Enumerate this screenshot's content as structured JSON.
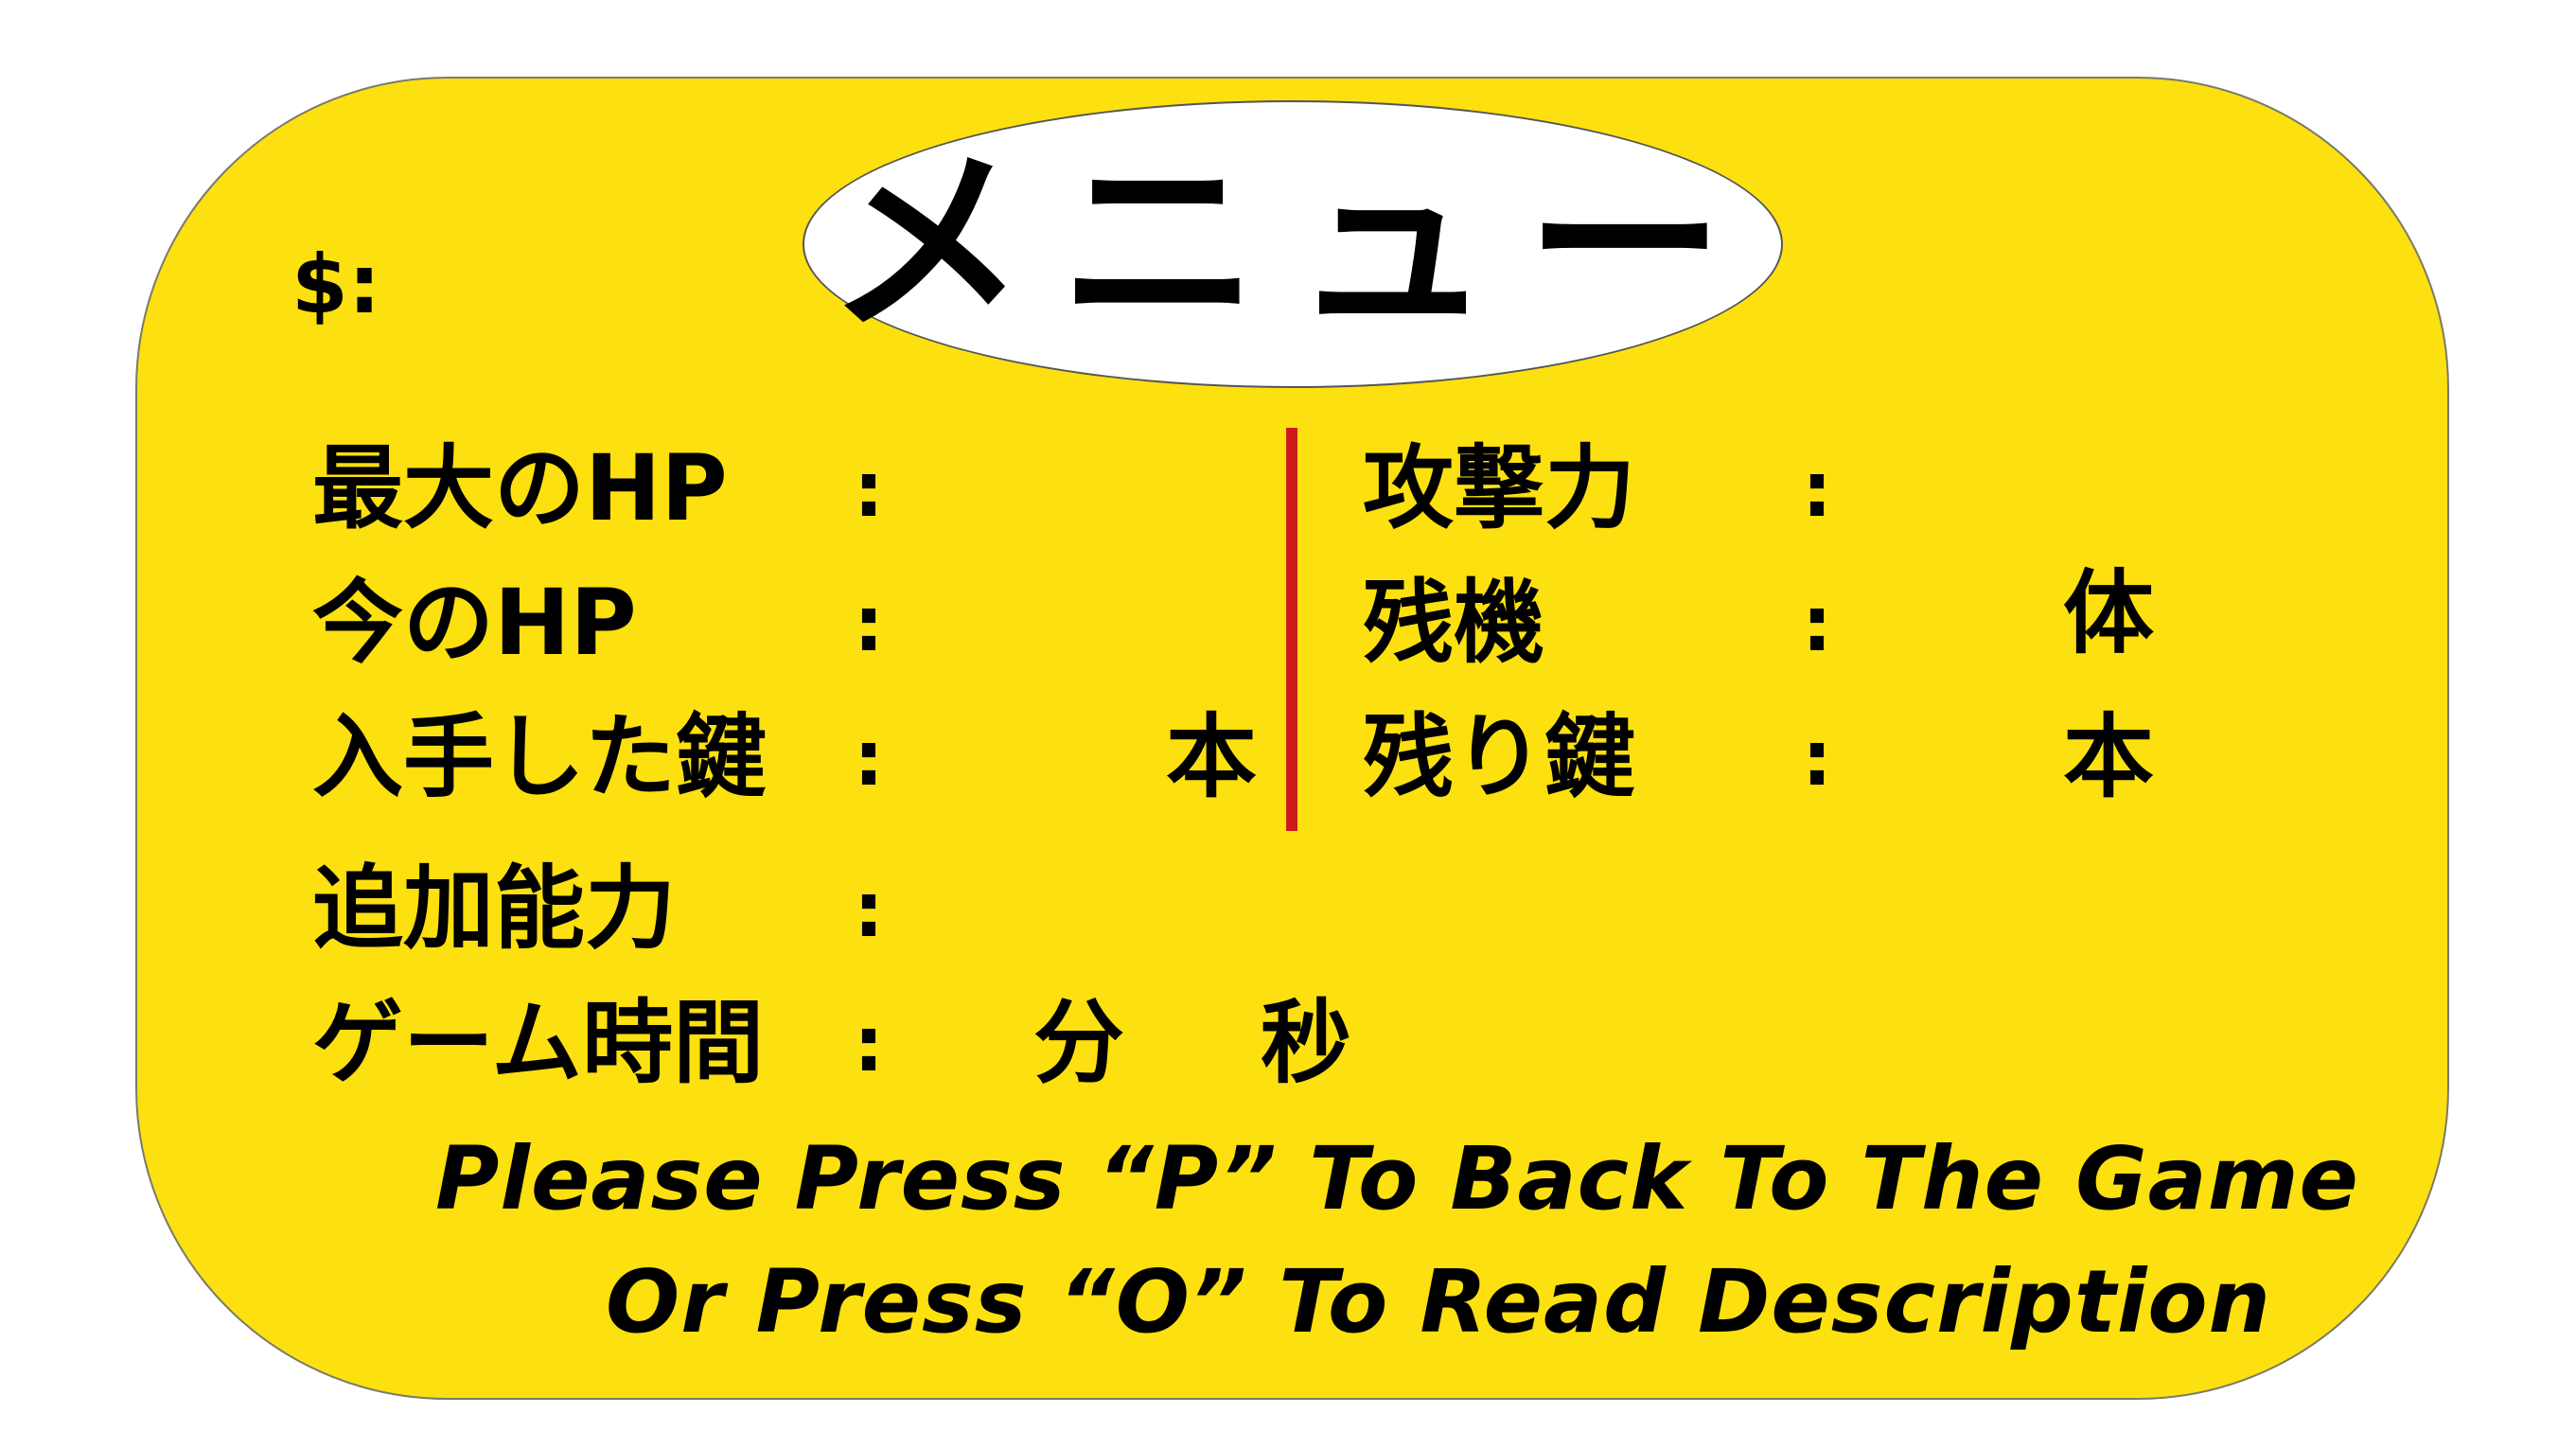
{
  "title": "メニュー",
  "money_label": "$:",
  "left_stats": [
    {
      "label": "最大のHP",
      "colon": ":",
      "unit": ""
    },
    {
      "label": "今のHP",
      "colon": ":",
      "unit": ""
    },
    {
      "label": "入手した鍵",
      "colon": ":",
      "unit": "本"
    }
  ],
  "right_stats": [
    {
      "label": "攻撃力",
      "colon": ":",
      "unit": ""
    },
    {
      "label": "残機",
      "colon": ":",
      "unit": "体"
    },
    {
      "label": "残り鍵",
      "colon": ":",
      "unit": "本"
    }
  ],
  "extra_ability": {
    "label": "追加能力",
    "colon": ":"
  },
  "game_time": {
    "label": "ゲーム時間",
    "colon": ":",
    "minutes_unit": "分",
    "seconds_unit": "秒"
  },
  "instructions": {
    "line1": "Please Press   “P”   To Back To The Game",
    "line2": "Or Press   “O”   To Read Description"
  },
  "colors": {
    "panel": "#fde00f",
    "divider": "#cc1a1a",
    "text": "#000000",
    "ellipse": "#ffffff"
  }
}
